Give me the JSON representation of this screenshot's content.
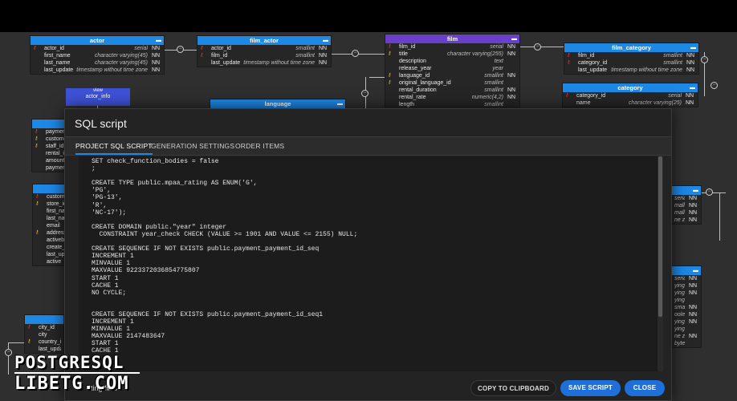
{
  "diagram": {
    "tables": {
      "actor": {
        "name": "actor",
        "rows": [
          {
            "key": "pk",
            "name": "actor_id",
            "type": "serial",
            "nn": "NN"
          },
          {
            "key": "",
            "name": "first_name",
            "type": "character varying(45)",
            "nn": "NN"
          },
          {
            "key": "",
            "name": "last_name",
            "type": "character varying(45)",
            "nn": "NN"
          },
          {
            "key": "",
            "name": "last_update",
            "type": "timestamp without time zone",
            "nn": "NN"
          }
        ]
      },
      "film_actor": {
        "name": "film_actor",
        "rows": [
          {
            "key": "pk",
            "name": "actor_id",
            "type": "smallint",
            "nn": "NN"
          },
          {
            "key": "pk",
            "name": "film_id",
            "type": "smallint",
            "nn": "NN"
          },
          {
            "key": "",
            "name": "last_update",
            "type": "timestamp without time zone",
            "nn": "NN"
          }
        ]
      },
      "film": {
        "name": "film",
        "rows": [
          {
            "key": "pk",
            "name": "film_id",
            "type": "serial",
            "nn": "NN"
          },
          {
            "key": "y",
            "name": "title",
            "type": "character varying(255)",
            "nn": "NN"
          },
          {
            "key": "",
            "name": "description",
            "type": "text",
            "nn": ""
          },
          {
            "key": "",
            "name": "release_year",
            "type": "year",
            "nn": ""
          },
          {
            "key": "y",
            "name": "language_id",
            "type": "smallint",
            "nn": "NN"
          },
          {
            "key": "y",
            "name": "original_language_id",
            "type": "smallint",
            "nn": ""
          },
          {
            "key": "",
            "name": "rental_duration",
            "type": "smallint",
            "nn": "NN"
          },
          {
            "key": "",
            "name": "rental_rate",
            "type": "numeric(4,2)",
            "nn": "NN"
          },
          {
            "key": "",
            "name": "length",
            "type": "smallint",
            "nn": ""
          }
        ]
      },
      "film_category": {
        "name": "film_category",
        "rows": [
          {
            "key": "pk",
            "name": "film_id",
            "type": "smallint",
            "nn": "NN"
          },
          {
            "key": "pk",
            "name": "category_id",
            "type": "smallint",
            "nn": "NN"
          },
          {
            "key": "",
            "name": "last_update",
            "type": "timestamp without time zone",
            "nn": "NN"
          }
        ]
      },
      "category": {
        "name": "category",
        "rows": [
          {
            "key": "pk",
            "name": "category_id",
            "type": "serial",
            "nn": "NN"
          },
          {
            "key": "",
            "name": "name",
            "type": "character varying(25)",
            "nn": "NN"
          }
        ]
      },
      "language": {
        "name": "language"
      },
      "payment": {
        "rows": [
          {
            "key": "pk",
            "name": "paymen"
          },
          {
            "key": "y",
            "name": "custome"
          },
          {
            "key": "y",
            "name": "staff_id"
          },
          {
            "key": "",
            "name": "rental_i"
          },
          {
            "key": "",
            "name": "amount"
          },
          {
            "key": "",
            "name": "paymen"
          }
        ]
      },
      "customer": {
        "rows": [
          {
            "key": "pk",
            "name": "custome"
          },
          {
            "key": "y",
            "name": "store_id"
          },
          {
            "key": "",
            "name": "first_na"
          },
          {
            "key": "",
            "name": "last_na"
          },
          {
            "key": "",
            "name": "email"
          },
          {
            "key": "y",
            "name": "address"
          },
          {
            "key": "",
            "name": "activeb"
          },
          {
            "key": "",
            "name": "create_"
          },
          {
            "key": "",
            "name": "last_up"
          },
          {
            "key": "",
            "name": "active"
          }
        ]
      },
      "city": {
        "rows": [
          {
            "key": "pk",
            "name": "city_id"
          },
          {
            "key": "",
            "name": "city"
          },
          {
            "key": "y",
            "name": "country_id"
          },
          {
            "key": "",
            "name": "last_upda"
          }
        ]
      },
      "right1": {
        "rows": [
          {
            "type": "serial",
            "nn": "NN"
          },
          {
            "type": "mallint",
            "nn": "NN"
          },
          {
            "type": "mallint",
            "nn": "NN"
          },
          {
            "type": "ne zone",
            "nn": "NN"
          }
        ]
      },
      "right2": {
        "rows": [
          {
            "type": "serial",
            "nn": "NN"
          },
          {
            "type": "ying(45)",
            "nn": "NN"
          },
          {
            "type": "ying(45)",
            "nn": "NN"
          },
          {
            "type": "ying(50)",
            "nn": ""
          },
          {
            "type": "smallint",
            "nn": "NN"
          },
          {
            "type": "oolean",
            "nn": "NN"
          },
          {
            "type": "ying(16)",
            "nn": "NN"
          },
          {
            "type": "ying(40)",
            "nn": ""
          },
          {
            "type": "ne zone",
            "nn": "NN"
          },
          {
            "type": "bytea",
            "nn": ""
          }
        ]
      }
    },
    "view": {
      "label": "view",
      "name": "actor_info"
    },
    "rel_markers": {
      "minus": "−",
      "plus": "+"
    }
  },
  "dialog": {
    "title": "SQL script",
    "tabs": [
      {
        "label": "PROJECT SQL SCRIPT",
        "active": true
      },
      {
        "label": "GENERATION SETTINGS",
        "active": false
      },
      {
        "label": "ORDER ITEMS",
        "active": false
      }
    ],
    "sql": [
      "SET check_function_bodies = false",
      ";",
      "",
      "CREATE TYPE public.mpaa_rating AS ENUM('G',",
      "'PG',",
      "'PG-13',",
      "'R',",
      "'NC-17');",
      "",
      "CREATE DOMAIN public.\"year\" integer",
      "  CONSTRAINT year_check CHECK (VALUE >= 1901 AND VALUE <= 2155) NULL;",
      "",
      "CREATE SEQUENCE IF NOT EXISTS public.payment_payment_id_seq",
      "INCREMENT 1",
      "MINVALUE 1",
      "MAXVALUE 9223372036854775807",
      "START 1",
      "CACHE 1",
      "NO CYCLE;",
      "",
      "",
      "CREATE SEQUENCE IF NOT EXISTS public.payment_payment_id_seq1",
      "INCREMENT 1",
      "MINVALUE 1",
      "MAXVALUE 2147483647",
      "START 1",
      "CACHE 1"
    ],
    "footer_text": "ting files",
    "buttons": {
      "copy": "COPY TO CLIPBOARD",
      "save": "SAVE SCRIPT",
      "close": "CLOSE"
    }
  },
  "watermark": {
    "line1": "POSTGRESQL",
    "line2": "LIBETG.COM"
  },
  "colors": {
    "accent": "#1e88e5",
    "film_header": "#6a3fc9",
    "view": "#3f51d6",
    "primary_key": "#e53935",
    "foreign_key": "#e5b535"
  }
}
